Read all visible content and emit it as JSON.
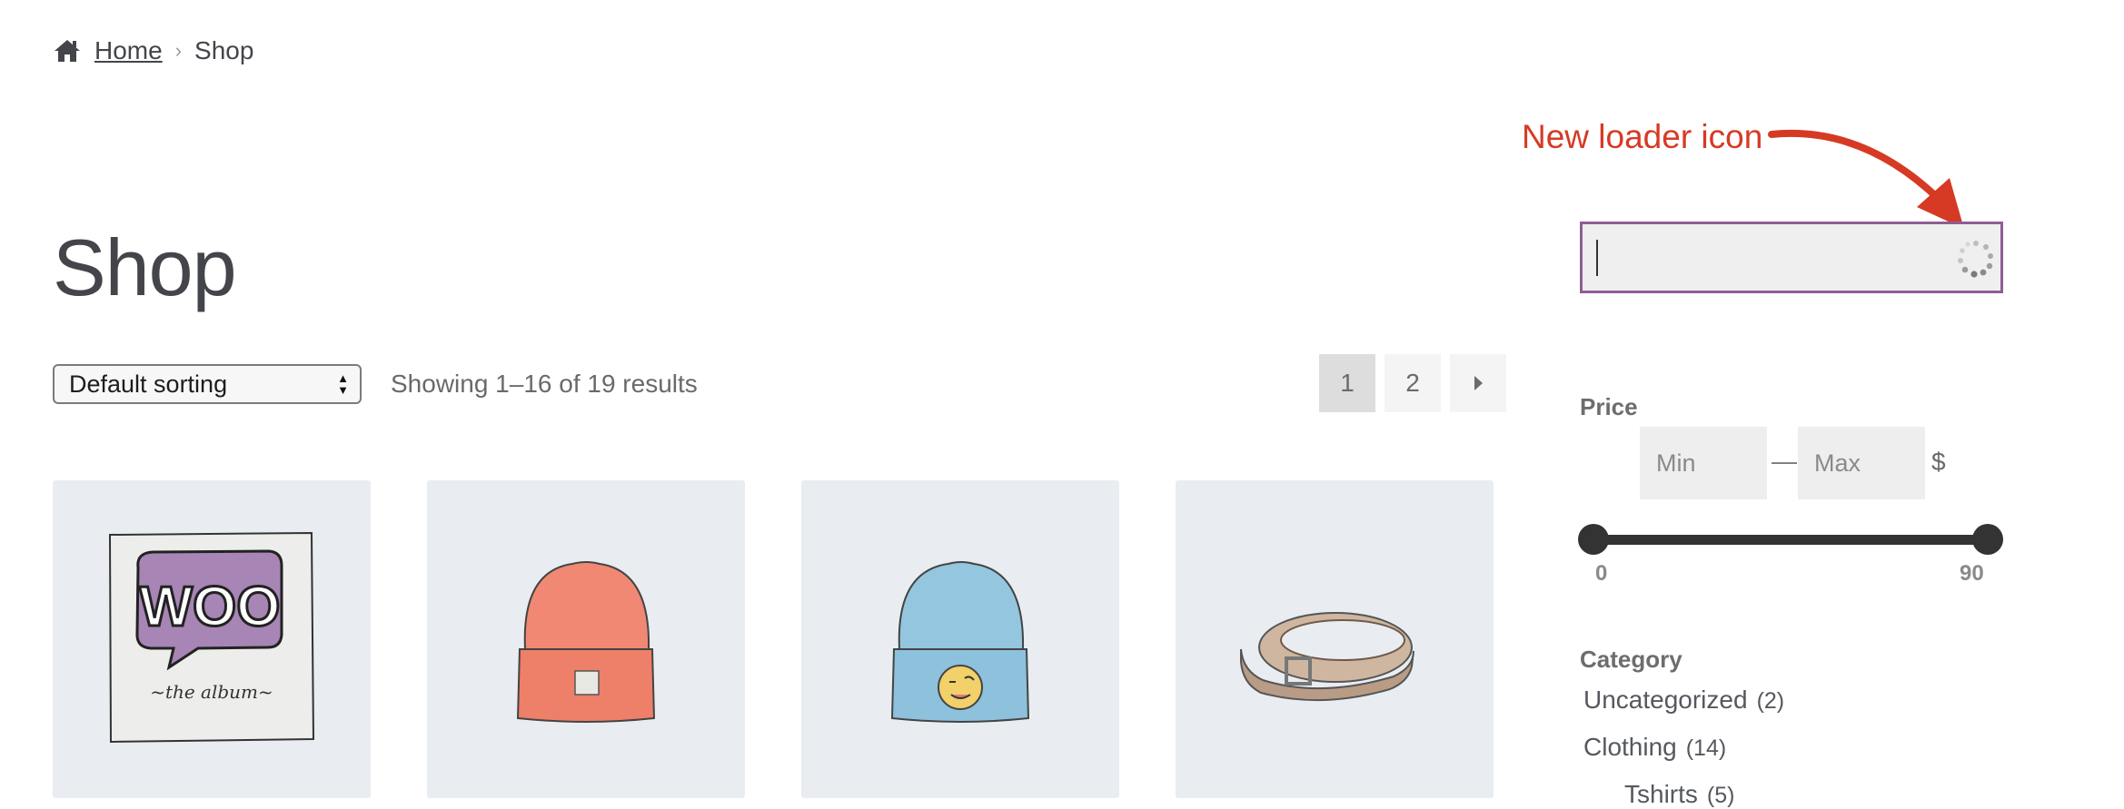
{
  "breadcrumb": {
    "home": "Home",
    "current": "Shop",
    "home_icon": "home-icon"
  },
  "page_title": "Shop",
  "toolbar": {
    "sorting": "Default sorting",
    "result_count": "Showing 1–16 of 19 results"
  },
  "pagination": {
    "current": "1",
    "page2": "2",
    "next_icon": "caret-right-icon"
  },
  "products": [
    {
      "name": "woo-album-image"
    },
    {
      "name": "orange-beanie-image"
    },
    {
      "name": "blue-beanie-image"
    },
    {
      "name": "belt-image"
    }
  ],
  "annotation": {
    "text": "New loader icon",
    "color": "#d63a24"
  },
  "search": {
    "value": "",
    "loader_icon": "spinner-icon"
  },
  "price_filter": {
    "title": "Price",
    "min_placeholder": "Min",
    "max_placeholder": "Max",
    "separator": "—",
    "currency": "$",
    "range_min": "0",
    "range_max": "90"
  },
  "category": {
    "title": "Category",
    "items": [
      {
        "label": "Uncategorized",
        "count": "(2)"
      },
      {
        "label": "Clothing",
        "count": "(14)"
      },
      {
        "label": "Tshirts",
        "count": "(5)"
      }
    ]
  },
  "colors": {
    "accent": "#8f5d95",
    "tile_bg": "#e9edf1"
  }
}
